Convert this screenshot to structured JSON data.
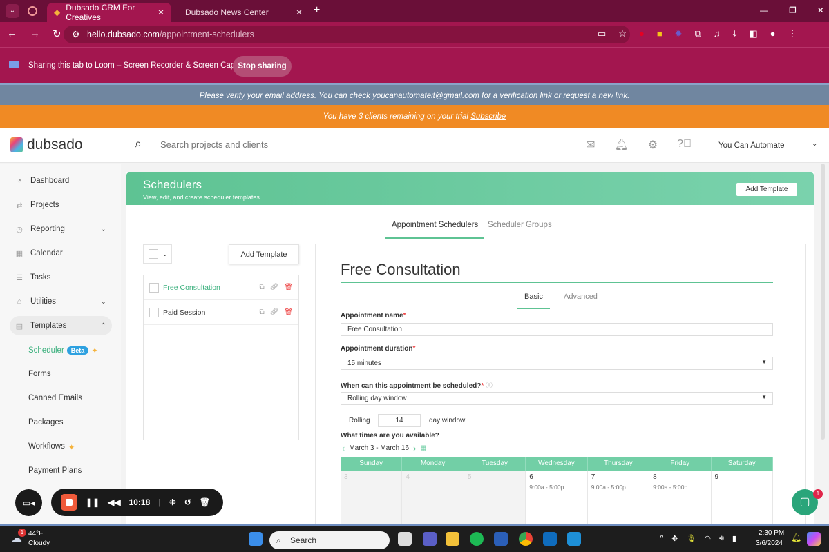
{
  "browser": {
    "tabs": [
      {
        "title": "Dubsado CRM For Creatives"
      },
      {
        "title": "Dubsado News Center"
      }
    ],
    "url_host": "hello.dubsado.com",
    "url_path": "/appointment-schedulers"
  },
  "sharing": {
    "text": "Sharing this tab to Loom – Screen Recorder & Screen Capture",
    "stop_label": "Stop sharing"
  },
  "banners": {
    "verify_text": "Please verify your email address. You can check youcanautomateit@gmail.com for a verification link or ",
    "verify_link": "request a new link.",
    "trial_text": "You have 3 clients remaining on your trial ",
    "trial_link": "Subscribe"
  },
  "header": {
    "logo": "dubsado",
    "search_placeholder": "Search projects and clients",
    "user": "You Can Automate"
  },
  "sidebar": {
    "items": [
      {
        "label": "Dashboard"
      },
      {
        "label": "Projects"
      },
      {
        "label": "Reporting"
      },
      {
        "label": "Calendar"
      },
      {
        "label": "Tasks"
      },
      {
        "label": "Utilities"
      },
      {
        "label": "Templates"
      }
    ],
    "sub": [
      {
        "label": "Scheduler"
      },
      {
        "label": "Forms"
      },
      {
        "label": "Canned Emails"
      },
      {
        "label": "Packages"
      },
      {
        "label": "Workflows"
      },
      {
        "label": "Payment Plans"
      }
    ],
    "beta": "Beta"
  },
  "page": {
    "title": "Schedulers",
    "subtitle": "View, edit, and create scheduler templates",
    "add_template": "Add Template",
    "tabs": [
      "Appointment Schedulers",
      "Scheduler Groups"
    ],
    "list_add": "Add Template",
    "templates": [
      {
        "name": "Free Consultation"
      },
      {
        "name": "Paid Session"
      }
    ]
  },
  "editor": {
    "title": "Free Consultation",
    "tabs": [
      "Basic",
      "Advanced"
    ],
    "name_label": "Appointment name",
    "name_value": "Free Consultation",
    "duration_label": "Appointment duration",
    "duration_value": "15 minutes",
    "when_label": "When can this appointment be scheduled?",
    "when_value": "Rolling day window",
    "rolling_label": "Rolling",
    "rolling_value": "14",
    "rolling_suffix": "day window",
    "avail_label": "What times are you available?",
    "range": "March 3 -  March 16",
    "days": [
      "Sunday",
      "Monday",
      "Tuesday",
      "Wednesday",
      "Thursday",
      "Friday",
      "Saturday"
    ],
    "dates": [
      {
        "d": "3",
        "t": ""
      },
      {
        "d": "4",
        "t": ""
      },
      {
        "d": "5",
        "t": ""
      },
      {
        "d": "6",
        "t": "9:00a - 5:00p"
      },
      {
        "d": "7",
        "t": "9:00a - 5:00p"
      },
      {
        "d": "8",
        "t": "9:00a - 5:00p"
      },
      {
        "d": "9",
        "t": ""
      }
    ]
  },
  "loom": {
    "timer": "10:18"
  },
  "chat": {
    "badge": "1"
  },
  "taskbar": {
    "temp": "44°F",
    "weather": "Cloudy",
    "search": "Search",
    "time": "2:30 PM",
    "date": "3/6/2024",
    "weather_badge": "1"
  }
}
